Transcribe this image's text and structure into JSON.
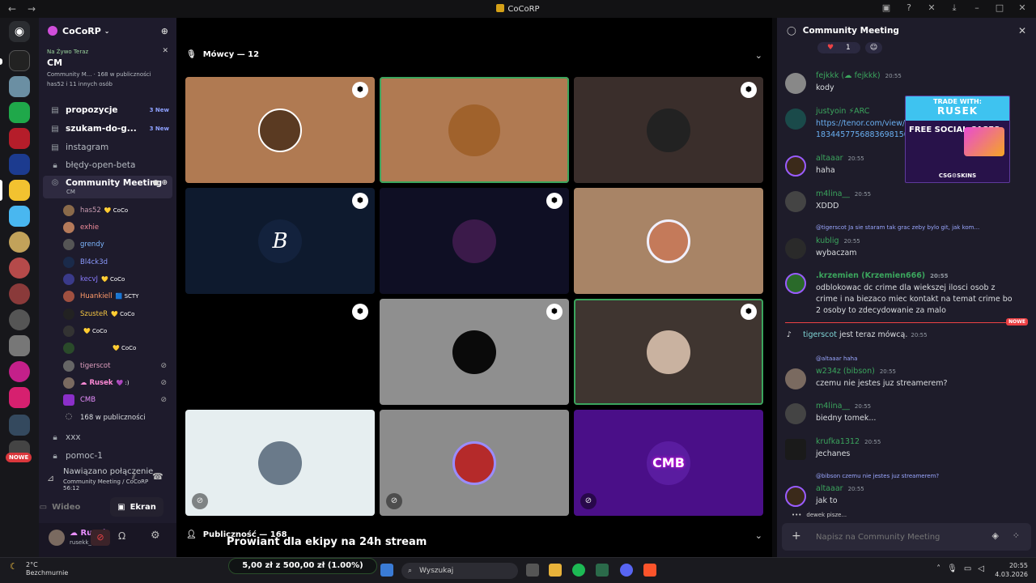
{
  "window": {
    "title": "CoCoRP",
    "back": "←",
    "forward": "→"
  },
  "server": {
    "name": "CoCoRP"
  },
  "live": {
    "label": "Na Żywo Teraz",
    "channel": "CM",
    "info": "Community M... · 168 w publiczności",
    "members": "has52 i 11 innych osób"
  },
  "channels": [
    {
      "name": "propozycje",
      "badge": "3 New"
    },
    {
      "name": "szukam-do-g...",
      "badge": "3 New"
    },
    {
      "name": "instagram"
    },
    {
      "name": "błędy-open-beta"
    },
    {
      "name": "Community Meeting",
      "sub": "CM"
    },
    {
      "name": "xxx"
    },
    {
      "name": "pomoc-1"
    }
  ],
  "voice_users": [
    {
      "name": "has52",
      "tag": "💛 CoCo",
      "color": "#c79bb0"
    },
    {
      "name": "exhie",
      "tag": "",
      "color": "#f28c9b"
    },
    {
      "name": "grendy",
      "tag": "",
      "color": "#7eb7ff"
    },
    {
      "name": "Bl4ck3d",
      "tag": "",
      "color": "#8c9bff"
    },
    {
      "name": "kecvJ",
      "tag": "💛 CoCo",
      "color": "#8a7cff"
    },
    {
      "name": "Huankiell",
      "tag": "🟦 SCTY",
      "color": "#ff9a6a"
    },
    {
      "name": "SzusteR",
      "tag": "💛 CoCo",
      "color": "#f4c542"
    },
    {
      "name": "",
      "tag": "💛 CoCo",
      "color": "#cccccc"
    },
    {
      "name": "",
      "tag": "💛 CoCo",
      "color": "#cccccc"
    },
    {
      "name": "tigerscot",
      "tag": "",
      "color": "#e0a0c0"
    },
    {
      "name": "☁ Rusek",
      "tag": "💜 :)",
      "color": "#ff8ad6"
    },
    {
      "name": "CMB",
      "tag": "",
      "color": "#e88fff"
    },
    {
      "name": "168 w publiczności",
      "tag": "",
      "color": "#dbdee1"
    }
  ],
  "connection": {
    "status": "Nawiązano połączenie",
    "channel": "Community Meeting / CoCoRP",
    "time": "56:12"
  },
  "buttons": {
    "video": "Wideo",
    "screen": "Ekran"
  },
  "user": {
    "name": "☁ Rusek",
    "handle": "rusekk_"
  },
  "stage": {
    "speakers": "Mówcy — 12",
    "audience": "Publiczność — 168",
    "overlay": "Prowiant dla ekipy na 24h stream"
  },
  "chat": {
    "title": "Community Meeting",
    "reaction_count": "1",
    "placeholder": "Napisz na Community Meeting",
    "typing": "dewek pisze...",
    "new_label": "NOWE",
    "system": {
      "user": "tigerscot",
      "text": "jest teraz mówcą.",
      "time": "20:55"
    },
    "messages": [
      {
        "name": "fejkkk (☁ fejkkk)",
        "color": "#3ba55d",
        "time": "20:55",
        "text": "kody"
      },
      {
        "name": "justyoin ⚡ARC",
        "color": "#3ba55d",
        "time": "",
        "text": "https://tenor.com/view/ 18344577568836981509"
      },
      {
        "name": "altaaar",
        "color": "#3ba55d",
        "time": "20:55",
        "text": "haha"
      },
      {
        "name": "m4lina__",
        "color": "#3ba55d",
        "time": "20:55",
        "text": "XDDD"
      },
      {
        "reply": "@tigerscot Ja sie staram tak grac zeby bylo git, jak kom...",
        "name": "kublig",
        "color": "#3ba55d",
        "time": "20:55",
        "text": "wybaczam"
      },
      {
        "name": ".krzemien (Krzemien666)",
        "color": "#3ba55d",
        "time": "20:55",
        "text": "odblokowac dc crime dla wiekszej ilosci osob z crime i na biezaco miec kontakt na temat crime bo 2 osoby to zdecydowanie za malo"
      },
      {
        "reply": "@altaaar haha",
        "name": "w234z (bibson)",
        "color": "#3ba55d",
        "time": "20:55",
        "text": "czemu nie jestes juz streamerem?"
      },
      {
        "name": "m4lina__",
        "color": "#3ba55d",
        "time": "20:55",
        "text": "biedny tomek..."
      },
      {
        "name": "krufka1312",
        "color": "#3ba55d",
        "time": "20:55",
        "text": "jechanes"
      },
      {
        "reply": "@bibson czemu nie jestes juz streamerem?",
        "name": "altaaar",
        "color": "#3ba55d",
        "time": "20:55",
        "text": "jak to"
      }
    ]
  },
  "ad": {
    "top": "TRADE WITH:",
    "name": "RUSEK",
    "mid": "FREE SOCIAL CASES",
    "bottom": "CSG⚙SKINS"
  },
  "taskbar": {
    "weather_temp": "2°C",
    "weather_desc": "Bezchmurnie",
    "donation": "5,00 zł z 500,00 zł (1.00%)",
    "search": "Wyszukaj",
    "time": "20:55",
    "date": "4.03.2026"
  }
}
